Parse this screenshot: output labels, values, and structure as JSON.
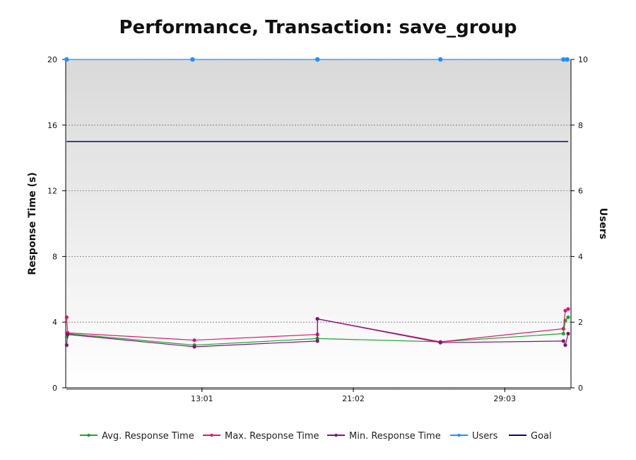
{
  "chart_data": {
    "type": "line",
    "title": "Performance, Transaction: save_group",
    "y_left_label": "Response Time (s)",
    "y_right_label": "Users",
    "y_left_ticks": [
      "0",
      "4",
      "8",
      "12",
      "16",
      "20"
    ],
    "y_right_ticks": [
      "0",
      "2",
      "4",
      "6",
      "8",
      "10"
    ],
    "x_tick_labels": [
      "13:01",
      "21:02",
      "29:03"
    ],
    "x_ticks_min": [
      13.0,
      21.0,
      29.0
    ],
    "xlim": [
      5.8,
      32.5
    ],
    "ylim_left": [
      0,
      20
    ],
    "ylim_right": [
      0,
      10
    ],
    "grid": true,
    "legend_position": "bottom",
    "colors": {
      "plot_background_top": "#d9d9d9",
      "plot_background_bottom": "#ffffff",
      "grid": "#777777"
    },
    "series": [
      {
        "name": "Avg. Response Time",
        "axis": "left",
        "color": "#1aa52b",
        "points": [
          [
            5.85,
            3.1
          ],
          [
            5.9,
            3.3
          ],
          [
            12.6,
            2.6
          ],
          [
            19.1,
            3.0
          ],
          [
            25.6,
            2.8
          ],
          [
            32.1,
            3.3
          ],
          [
            32.2,
            4.1
          ],
          [
            32.35,
            4.3
          ]
        ]
      },
      {
        "name": "Max. Response Time",
        "axis": "left",
        "color": "#e0196c",
        "points": [
          [
            5.85,
            4.3
          ],
          [
            5.9,
            3.35
          ],
          [
            12.6,
            2.9
          ],
          [
            19.1,
            3.25
          ],
          [
            19.1,
            4.2
          ],
          [
            25.6,
            2.8
          ],
          [
            32.1,
            3.6
          ],
          [
            32.2,
            4.7
          ],
          [
            32.35,
            4.8
          ]
        ]
      },
      {
        "name": "Min. Response Time",
        "axis": "left",
        "color": "#80147a",
        "points": [
          [
            5.85,
            2.6
          ],
          [
            5.9,
            3.25
          ],
          [
            12.6,
            2.5
          ],
          [
            19.1,
            2.85
          ],
          [
            19.1,
            4.2
          ],
          [
            25.6,
            2.75
          ],
          [
            32.1,
            2.85
          ],
          [
            32.2,
            2.6
          ],
          [
            32.35,
            3.3
          ]
        ]
      },
      {
        "name": "Users",
        "axis": "right",
        "color": "#1e90ff",
        "points": [
          [
            5.85,
            10
          ],
          [
            12.5,
            10
          ],
          [
            19.1,
            10
          ],
          [
            25.6,
            10
          ],
          [
            32.1,
            10
          ],
          [
            32.3,
            10
          ]
        ]
      },
      {
        "name": "Goal",
        "axis": "left",
        "color": "#0b0b5e",
        "points": [
          [
            5.85,
            15
          ],
          [
            32.35,
            15
          ]
        ]
      }
    ]
  }
}
